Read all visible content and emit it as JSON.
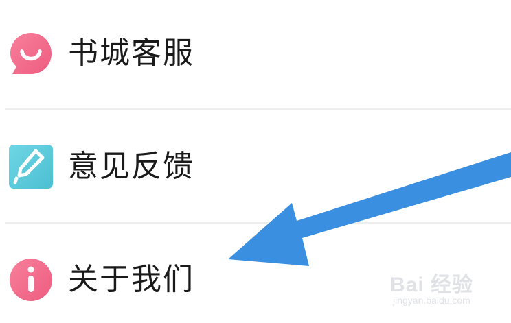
{
  "menu": {
    "items": [
      {
        "label": "书城客服",
        "icon": "customer-service-icon",
        "color": "#f36a8a"
      },
      {
        "label": "意见反馈",
        "icon": "feedback-pencil-icon",
        "color": "#5ac9da"
      },
      {
        "label": "关于我们",
        "icon": "info-icon",
        "color": "#f36a8a"
      }
    ]
  },
  "annotation": {
    "arrow_color": "#3b8fe0"
  },
  "watermark": {
    "logo": "Bai 经验",
    "url": "jingyan.baidu.com"
  }
}
